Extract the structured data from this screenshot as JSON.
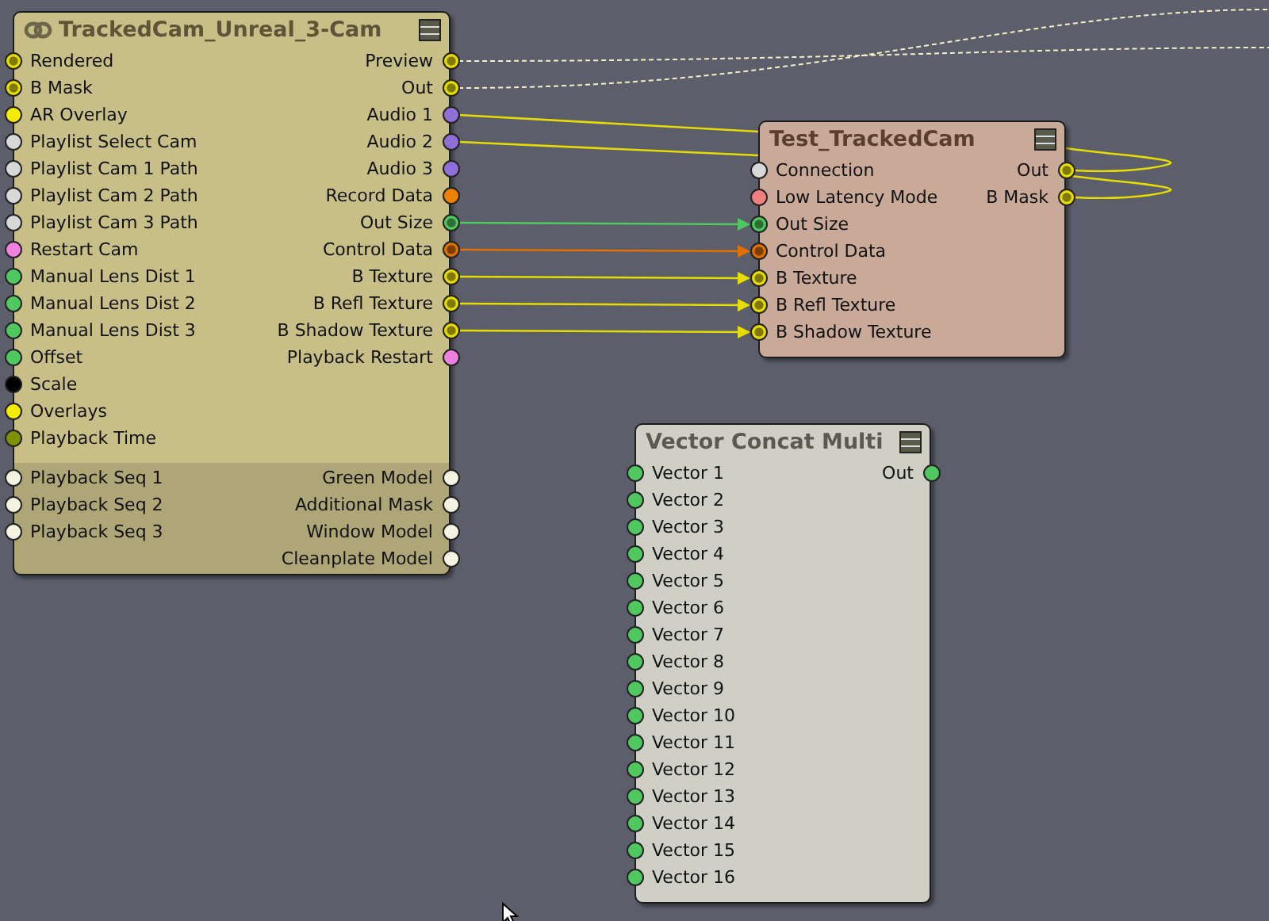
{
  "nodes": [
    {
      "title": "TrackedCam_Unreal_3-Cam",
      "linked": true,
      "color": "#c8bf88",
      "sections": [
        {
          "kind": "main",
          "left": [
            {
              "label": "Rendered",
              "color": "#e6dc00",
              "connected": true
            },
            {
              "label": "B Mask",
              "color": "#e6dc00",
              "connected": true
            },
            {
              "label": "AR Overlay",
              "color": "#f4ec00",
              "connected": false
            },
            {
              "label": "Playlist Select Cam",
              "color": "#d8d8d8",
              "connected": false
            },
            {
              "label": "Playlist Cam 1 Path",
              "color": "#d8d8d8",
              "connected": false
            },
            {
              "label": "Playlist Cam 2 Path",
              "color": "#d8d8d8",
              "connected": false
            },
            {
              "label": "Playlist Cam 3 Path",
              "color": "#d8d8d8",
              "connected": false
            },
            {
              "label": "Restart Cam",
              "color": "#f080e0",
              "connected": false
            },
            {
              "label": "Manual Lens Dist 1",
              "color": "#50c860",
              "connected": false
            },
            {
              "label": "Manual Lens Dist 2",
              "color": "#50c860",
              "connected": false
            },
            {
              "label": "Manual Lens Dist 3",
              "color": "#50c860",
              "connected": false
            },
            {
              "label": "Offset",
              "color": "#50c860",
              "connected": false
            },
            {
              "label": "Scale",
              "color": "#000000",
              "connected": false
            },
            {
              "label": "Overlays",
              "color": "#f4ec00",
              "connected": false
            },
            {
              "label": "Playback Time",
              "color": "#7f9000",
              "connected": false
            }
          ],
          "right": [
            {
              "label": "Preview",
              "color": "#e6dc00",
              "connected": true
            },
            {
              "label": "Out",
              "color": "#e6dc00",
              "connected": true
            },
            {
              "label": "Audio 1",
              "color": "#9070d8",
              "connected": false
            },
            {
              "label": "Audio 2",
              "color": "#9070d8",
              "connected": false
            },
            {
              "label": "Audio 3",
              "color": "#9070d8",
              "connected": false
            },
            {
              "label": "Record Data",
              "color": "#f08000",
              "connected": false
            },
            {
              "label": "Out Size",
              "color": "#50c860",
              "connected": true
            },
            {
              "label": "Control Data",
              "color": "#e07000",
              "connected": true
            },
            {
              "label": "B Texture",
              "color": "#e6dc00",
              "connected": true
            },
            {
              "label": "B Refl Texture",
              "color": "#e6dc00",
              "connected": true
            },
            {
              "label": "B Shadow Texture",
              "color": "#e6dc00",
              "connected": true
            },
            {
              "label": "Playback Restart",
              "color": "#f080e0",
              "connected": false
            }
          ]
        },
        {
          "kind": "extra",
          "left": [
            {
              "label": "Playback Seq 1",
              "color": "#f4f2e0",
              "connected": false
            },
            {
              "label": "Playback Seq 2",
              "color": "#f4f2e0",
              "connected": false
            },
            {
              "label": "Playback Seq 3",
              "color": "#f4f2e0",
              "connected": false
            }
          ],
          "right": [
            {
              "label": "Green Model",
              "color": "#f4f2e0",
              "connected": false
            },
            {
              "label": "Additional Mask",
              "color": "#f4f2e0",
              "connected": false
            },
            {
              "label": "Window Model",
              "color": "#f4f2e0",
              "connected": false
            },
            {
              "label": "Cleanplate Model",
              "color": "#f4f2e0",
              "connected": false
            }
          ]
        }
      ]
    },
    {
      "title": "Test_TrackedCam",
      "linked": false,
      "color": "#c9aa98",
      "sections": [
        {
          "kind": "main",
          "left": [
            {
              "label": "Connection",
              "color": "#d8d8d8",
              "connected": false
            },
            {
              "label": "Low Latency Mode",
              "color": "#f08080",
              "connected": false
            },
            {
              "label": "Out Size",
              "color": "#50c860",
              "connected": true
            },
            {
              "label": "Control Data",
              "color": "#e07000",
              "connected": true
            },
            {
              "label": "B Texture",
              "color": "#e6dc00",
              "connected": true
            },
            {
              "label": "B Refl Texture",
              "color": "#e6dc00",
              "connected": true
            },
            {
              "label": "B Shadow Texture",
              "color": "#e6dc00",
              "connected": true
            }
          ],
          "right": [
            {
              "label": "Out",
              "color": "#e6dc00",
              "connected": true
            },
            {
              "label": "B Mask",
              "color": "#e6dc00",
              "connected": true
            }
          ]
        }
      ]
    },
    {
      "title": "Vector Concat Multi",
      "linked": false,
      "color": "#cfcfc6",
      "sections": [
        {
          "kind": "main",
          "left": [
            {
              "label": "Vector 1",
              "color": "#50c860",
              "connected": false
            },
            {
              "label": "Vector 2",
              "color": "#50c860",
              "connected": false
            },
            {
              "label": "Vector 3",
              "color": "#50c860",
              "connected": false
            },
            {
              "label": "Vector 4",
              "color": "#50c860",
              "connected": false
            },
            {
              "label": "Vector 5",
              "color": "#50c860",
              "connected": false
            },
            {
              "label": "Vector 6",
              "color": "#50c860",
              "connected": false
            },
            {
              "label": "Vector 7",
              "color": "#50c860",
              "connected": false
            },
            {
              "label": "Vector 8",
              "color": "#50c860",
              "connected": false
            },
            {
              "label": "Vector 9",
              "color": "#50c860",
              "connected": false
            },
            {
              "label": "Vector 10",
              "color": "#50c860",
              "connected": false
            },
            {
              "label": "Vector 11",
              "color": "#50c860",
              "connected": false
            },
            {
              "label": "Vector 12",
              "color": "#50c860",
              "connected": false
            },
            {
              "label": "Vector 13",
              "color": "#50c860",
              "connected": false
            },
            {
              "label": "Vector 14",
              "color": "#50c860",
              "connected": false
            },
            {
              "label": "Vector 15",
              "color": "#50c860",
              "connected": false
            },
            {
              "label": "Vector 16",
              "color": "#50c860",
              "connected": false
            }
          ],
          "right": [
            {
              "label": "Out",
              "color": "#50c860",
              "connected": false
            }
          ]
        }
      ]
    }
  ]
}
